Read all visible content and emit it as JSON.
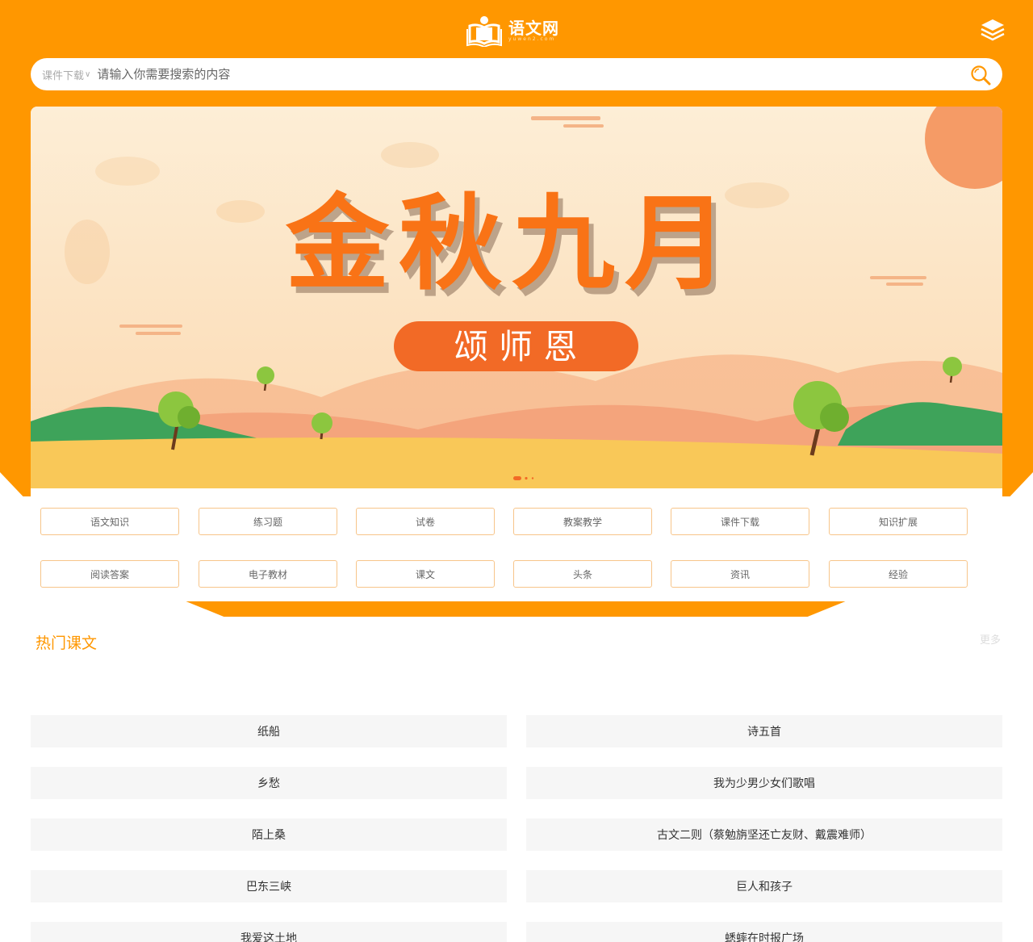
{
  "header": {
    "site_name": "语文网",
    "site_domain": "yuwen2.com"
  },
  "search": {
    "category": "课件下载",
    "placeholder": "请输入你需要搜索的内容"
  },
  "banner": {
    "headline": "金秋九月",
    "subtitle": "颂 师 恩",
    "active_slide": 1,
    "slide_count": 3
  },
  "categories": [
    "语文知识",
    "练习题",
    "试卷",
    "教案教学",
    "课件下载",
    "知识扩展",
    "阅读答案",
    "电子教材",
    "课文",
    "头条",
    "资讯",
    "经验"
  ],
  "hot_section": {
    "title": "热门课文",
    "more": "更多"
  },
  "hot_lessons": [
    "纸船",
    "诗五首",
    "乡愁",
    "我为少男少女们歌唱",
    "陌上桑",
    "古文二则（蔡勉旃坚还亡友财、戴震难师）",
    "巴东三峡",
    "巨人和孩子",
    "我爱这土地",
    "蟋蟀在时报广场"
  ],
  "colors": {
    "brand": "#ff9700",
    "banner_title": "#f97316",
    "button_border": "#f7c58a"
  }
}
